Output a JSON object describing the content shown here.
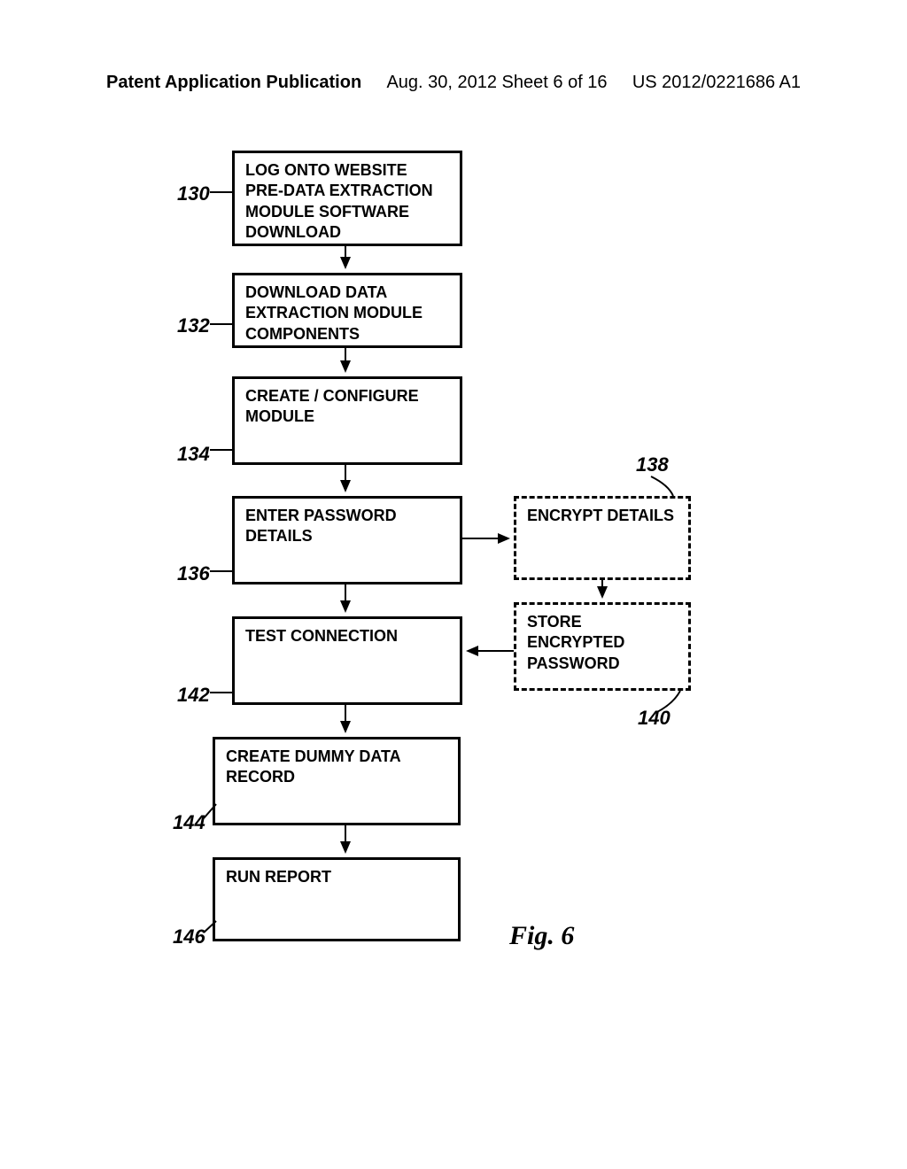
{
  "header": {
    "left": "Patent Application Publication",
    "mid": "Aug. 30, 2012  Sheet 6 of 16",
    "right": "US 2012/0221686 A1"
  },
  "boxes": {
    "b130": "LOG ONTO WEBSITE PRE-DATA EXTRACTION MODULE SOFTWARE DOWNLOAD",
    "b132": "DOWNLOAD DATA EXTRACTION MODULE COMPONENTS",
    "b134": "CREATE / CONFIGURE MODULE",
    "b136": "ENTER PASSWORD DETAILS",
    "b138": "ENCRYPT DETAILS",
    "b140": "STORE ENCRYPTED PASSWORD",
    "b142": "TEST CONNECTION",
    "b144": "CREATE DUMMY DATA RECORD",
    "b146": "RUN REPORT"
  },
  "refs": {
    "r130": "130",
    "r132": "132",
    "r134": "134",
    "r136": "136",
    "r138": "138",
    "r140": "140",
    "r142": "142",
    "r144": "144",
    "r146": "146"
  },
  "figure": "Fig. 6",
  "chart_data": {
    "type": "flowchart",
    "nodes": [
      {
        "id": 130,
        "label": "LOG ONTO WEBSITE PRE-DATA EXTRACTION MODULE SOFTWARE DOWNLOAD",
        "style": "solid"
      },
      {
        "id": 132,
        "label": "DOWNLOAD DATA EXTRACTION MODULE COMPONENTS",
        "style": "solid"
      },
      {
        "id": 134,
        "label": "CREATE / CONFIGURE MODULE",
        "style": "solid"
      },
      {
        "id": 136,
        "label": "ENTER PASSWORD DETAILS",
        "style": "solid"
      },
      {
        "id": 138,
        "label": "ENCRYPT DETAILS",
        "style": "dashed"
      },
      {
        "id": 140,
        "label": "STORE ENCRYPTED PASSWORD",
        "style": "dashed"
      },
      {
        "id": 142,
        "label": "TEST CONNECTION",
        "style": "solid"
      },
      {
        "id": 144,
        "label": "CREATE DUMMY DATA RECORD",
        "style": "solid"
      },
      {
        "id": 146,
        "label": "RUN REPORT",
        "style": "solid"
      }
    ],
    "edges": [
      {
        "from": 130,
        "to": 132
      },
      {
        "from": 132,
        "to": 134
      },
      {
        "from": 134,
        "to": 136
      },
      {
        "from": 136,
        "to": 142
      },
      {
        "from": 136,
        "to": 138
      },
      {
        "from": 138,
        "to": 140
      },
      {
        "from": 140,
        "to": 142
      },
      {
        "from": 142,
        "to": 144
      },
      {
        "from": 144,
        "to": 146
      }
    ],
    "figure_label": "Fig. 6"
  }
}
